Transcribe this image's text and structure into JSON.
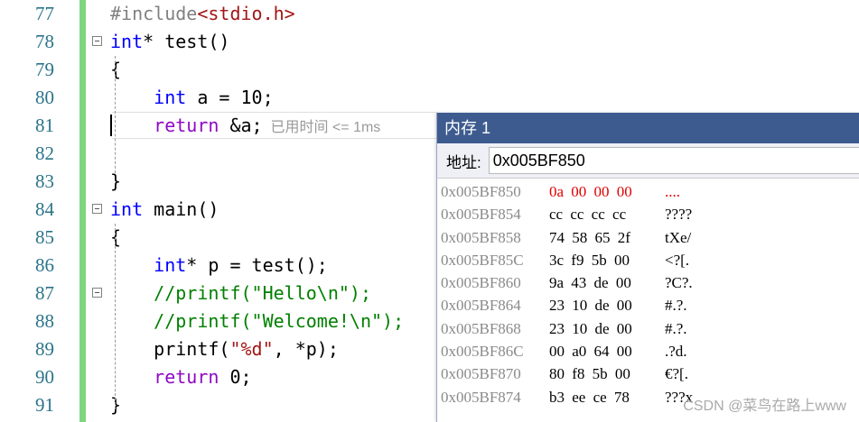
{
  "editor": {
    "line_numbers": [
      "77",
      "78",
      "79",
      "80",
      "81",
      "82",
      "83",
      "84",
      "85",
      "86",
      "87",
      "88",
      "89",
      "90",
      "91"
    ],
    "lines": [
      {
        "html_parts": [
          {
            "t": "#include",
            "c": "pp"
          },
          {
            "t": "<stdio.h>",
            "c": "str"
          }
        ]
      },
      {
        "html_parts": [
          {
            "t": "int",
            "c": "kw"
          },
          {
            "t": "* test()",
            "c": ""
          }
        ]
      },
      {
        "html_parts": [
          {
            "t": "{",
            "c": ""
          }
        ]
      },
      {
        "html_parts": [
          {
            "t": "    int",
            "c": "kw"
          },
          {
            "t": " a = 10;",
            "c": ""
          }
        ]
      },
      {
        "html_parts": [
          {
            "t": "    return",
            "c": "ret"
          },
          {
            "t": " &a;",
            "c": ""
          }
        ]
      },
      {
        "html_parts": []
      },
      {
        "html_parts": [
          {
            "t": "}",
            "c": ""
          }
        ]
      },
      {
        "html_parts": [
          {
            "t": "int",
            "c": "kw"
          },
          {
            "t": " main()",
            "c": ""
          }
        ]
      },
      {
        "html_parts": [
          {
            "t": "{",
            "c": ""
          }
        ]
      },
      {
        "html_parts": [
          {
            "t": "    int",
            "c": "kw"
          },
          {
            "t": "* p = test();",
            "c": ""
          }
        ]
      },
      {
        "html_parts": [
          {
            "t": "    //printf(\"Hello\\n\");",
            "c": "cmt"
          }
        ]
      },
      {
        "html_parts": [
          {
            "t": "    //printf(\"Welcome!\\n\");",
            "c": "cmt"
          }
        ]
      },
      {
        "html_parts": [
          {
            "t": "    printf(",
            "c": ""
          },
          {
            "t": "\"%d\"",
            "c": "str"
          },
          {
            "t": ", *p);",
            "c": ""
          }
        ]
      },
      {
        "html_parts": [
          {
            "t": "    return",
            "c": "ret"
          },
          {
            "t": " 0;",
            "c": ""
          }
        ]
      },
      {
        "html_parts": [
          {
            "t": "}",
            "c": ""
          }
        ]
      }
    ],
    "elapsed_hint": "已用时间 <= 1ms"
  },
  "memory_window": {
    "title": "内存 1",
    "address_label": "地址:",
    "address_value": "0x005BF850",
    "rows": [
      {
        "addr": "0x005BF850",
        "bytes": "0a 00 00 00",
        "ascii": "....",
        "changed": true
      },
      {
        "addr": "0x005BF854",
        "bytes": "cc cc cc cc",
        "ascii": "????",
        "changed": false
      },
      {
        "addr": "0x005BF858",
        "bytes": "74 58 65 2f",
        "ascii": "tXe/",
        "changed": false
      },
      {
        "addr": "0x005BF85C",
        "bytes": "3c f9 5b 00",
        "ascii": "<?[.",
        "changed": false
      },
      {
        "addr": "0x005BF860",
        "bytes": "9a 43 de 00",
        "ascii": "?C?.",
        "changed": false
      },
      {
        "addr": "0x005BF864",
        "bytes": "23 10 de 00",
        "ascii": "#.?.",
        "changed": false
      },
      {
        "addr": "0x005BF868",
        "bytes": "23 10 de 00",
        "ascii": "#.?.",
        "changed": false
      },
      {
        "addr": "0x005BF86C",
        "bytes": "00 a0 64 00",
        "ascii": ".?d.",
        "changed": false
      },
      {
        "addr": "0x005BF870",
        "bytes": "80 f8 5b 00",
        "ascii": "€?[.",
        "changed": false
      },
      {
        "addr": "0x005BF874",
        "bytes": "b3 ee ce 78",
        "ascii": "???x",
        "changed": false
      }
    ]
  },
  "watermark": "CSDN @菜鸟在路上www",
  "colors": {
    "keyword": "#0000ff",
    "return_kw": "#8f08c4",
    "string": "#a31515",
    "comment": "#008000",
    "title_bar": "#3e5b8f",
    "changed_bytes": "#e00000",
    "gutter_bar": "#7fd67f"
  }
}
